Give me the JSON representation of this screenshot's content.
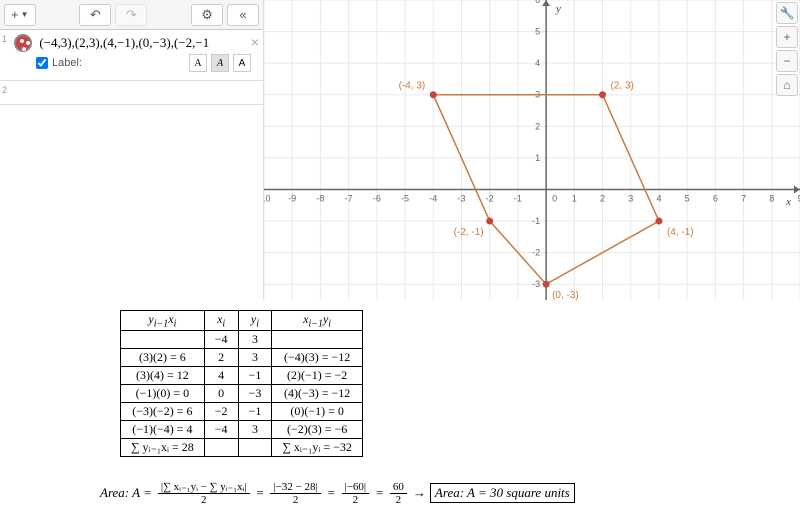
{
  "toolbar": {
    "add_label": "+",
    "undo_icon": "↶",
    "redo_icon": "↷",
    "settings_icon": "⚙",
    "collapse_icon": "«"
  },
  "expression": {
    "index": "1",
    "text": "(−4,3),(2,3),(4,−1),(0,−3),(−2,−1",
    "close": "×",
    "label_checkbox": "Label:",
    "font_a": "A",
    "font_ai": "A",
    "font_ab": "A",
    "index2": "2"
  },
  "graph_tools": {
    "wrench": "🔧",
    "plus": "+",
    "minus": "−",
    "home": "⌂"
  },
  "chart_data": {
    "type": "scatter",
    "title": "",
    "xlabel": "x",
    "ylabel": "y",
    "xlim": [
      -10,
      9
    ],
    "ylim": [
      -3.5,
      6
    ],
    "points": [
      {
        "x": -4,
        "y": 3,
        "label": "(-4, 3)"
      },
      {
        "x": 2,
        "y": 3,
        "label": "(2, 3)"
      },
      {
        "x": 4,
        "y": -1,
        "label": "(4, -1)"
      },
      {
        "x": 0,
        "y": -3,
        "label": "(0, -3)"
      },
      {
        "x": -2,
        "y": -1,
        "label": "(-2, -1)"
      }
    ],
    "polygon_closed": true
  },
  "table": {
    "headers": {
      "c1": "y",
      "c1sub": "i−1",
      "c1b": "x",
      "c1bsub": "i",
      "c2": "x",
      "c2sub": "i",
      "c3": "y",
      "c3sub": "i",
      "c4": "x",
      "c4sub": "i−1",
      "c4b": "y",
      "c4bsub": "i"
    },
    "rows": [
      {
        "a": "",
        "x": "−4",
        "y": "3",
        "b": ""
      },
      {
        "a": "(3)(2) = 6",
        "x": "2",
        "y": "3",
        "b": "(−4)(3) = −12"
      },
      {
        "a": "(3)(4) = 12",
        "x": "4",
        "y": "−1",
        "b": "(2)(−1) = −2"
      },
      {
        "a": "(−1)(0) = 0",
        "x": "0",
        "y": "−3",
        "b": "(4)(−3) = −12"
      },
      {
        "a": "(−3)(−2) = 6",
        "x": "−2",
        "y": "−1",
        "b": "(0)(−1) = 0"
      },
      {
        "a": "(−1)(−4) = 4",
        "x": "−4",
        "y": "3",
        "b": "(−2)(3) = −6"
      }
    ],
    "sum_left": "∑ yᵢ₋₁xᵢ = 28",
    "sum_right": "∑ xᵢ₋₁yᵢ = −32"
  },
  "formula": {
    "lhs": "Area: A =",
    "f1_num": "|∑ xᵢ₋₁yᵢ − ∑ yᵢ₋₁xᵢ|",
    "f1_den": "2",
    "eq": "=",
    "f2_num": "|−32 − 28|",
    "f2_den": "2",
    "f3_num": "|−60|",
    "f3_den": "2",
    "f4_num": "60",
    "f4_den": "2",
    "arrow": "→",
    "result": "Area: A = 30 square units"
  }
}
